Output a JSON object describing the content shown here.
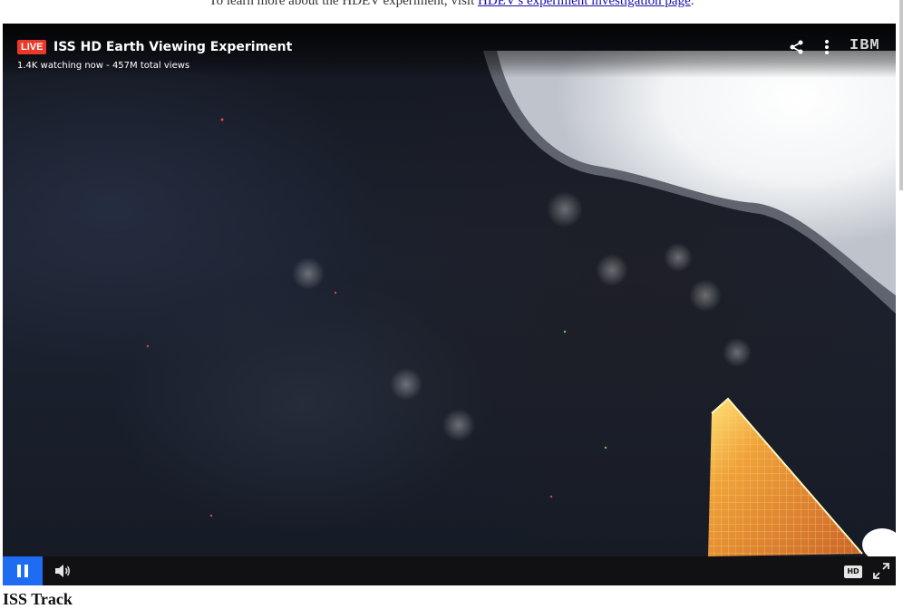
{
  "page": {
    "intro_prefix": "To learn more about the HDEV experiment, visit",
    "intro_link": "HDEV's experiment investigation page",
    "intro_suffix": ".",
    "bottom_heading": "ISS Track"
  },
  "player": {
    "live_label": "LIVE",
    "title": "ISS HD Earth Viewing Experiment",
    "stats": "1.4K watching now - 457M total views",
    "brand": "IBM",
    "hd_label": "HD",
    "icons": {
      "share": "share-icon",
      "more": "more-vertical-icon",
      "pause": "pause-icon",
      "volume": "volume-icon",
      "hd": "hd-icon",
      "fullscreen": "fullscreen-icon"
    }
  },
  "colors": {
    "live_red": "#e8392a",
    "play_blue": "#1d6cf2",
    "link_blue": "#1a0dab"
  }
}
